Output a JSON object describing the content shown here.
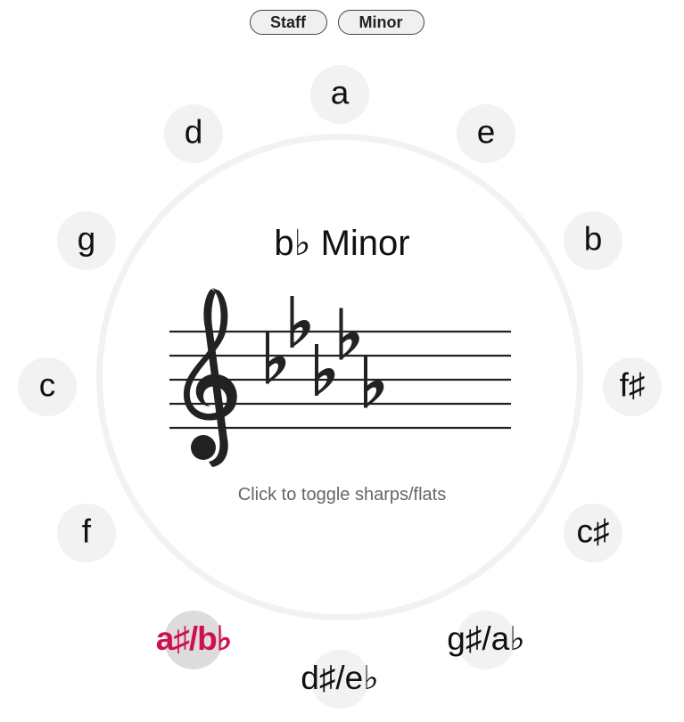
{
  "toolbar": {
    "staff_label": "Staff",
    "mode_label": "Minor"
  },
  "center": {
    "title": "b♭ Minor",
    "hint": "Click to toggle sharps/flats",
    "clef": "treble-clef",
    "key_signature": {
      "accidental": "flat",
      "count": 5,
      "notes": [
        "b",
        "e",
        "a",
        "d",
        "g"
      ]
    }
  },
  "circle": {
    "selected_index": 7,
    "keys": [
      {
        "label": "a",
        "selected": false
      },
      {
        "label": "e",
        "selected": false
      },
      {
        "label": "b",
        "selected": false
      },
      {
        "label": "f♯",
        "selected": false
      },
      {
        "label": "c♯",
        "selected": false
      },
      {
        "label": "g♯/a♭",
        "selected": false
      },
      {
        "label": "d♯/e♭",
        "selected": false
      },
      {
        "label": "a♯/b♭",
        "selected": true
      },
      {
        "label": "f",
        "selected": false
      },
      {
        "label": "c",
        "selected": false
      },
      {
        "label": "g",
        "selected": false
      },
      {
        "label": "d",
        "selected": false
      }
    ]
  },
  "colors": {
    "selected_text": "#d0104c",
    "key_bg": "#f2f2f2",
    "selected_bg": "#dcdcdc",
    "ring": "#f2f2f2"
  }
}
